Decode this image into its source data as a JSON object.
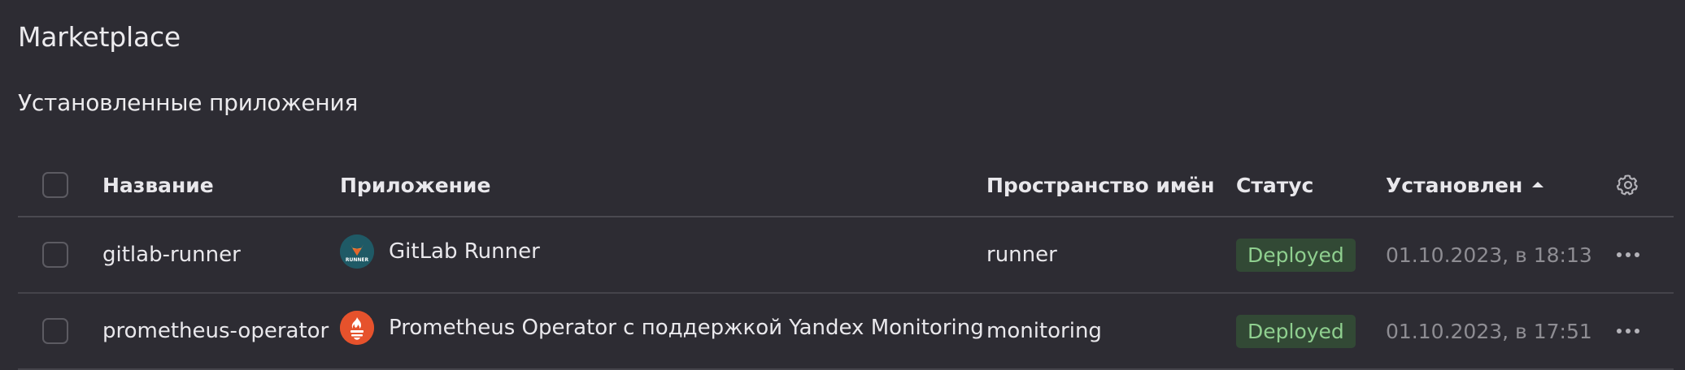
{
  "page": {
    "title": "Marketplace",
    "section_title": "Установленные приложения"
  },
  "table": {
    "columns": {
      "name": "Название",
      "app": "Приложение",
      "namespace": "Пространство имён",
      "status": "Статус",
      "installed": "Установлен"
    },
    "sort": {
      "column": "installed",
      "direction": "asc"
    },
    "rows": [
      {
        "name": "gitlab-runner",
        "app": "GitLab Runner",
        "app_icon": "gitlab-runner-icon",
        "app_icon_label": "RUNNER",
        "namespace": "runner",
        "status": "Deployed",
        "installed": "01.10.2023, в 18:13"
      },
      {
        "name": "prometheus-operator",
        "app": "Prometheus Operator с поддержкой Yandex Monitoring",
        "app_icon": "prometheus-icon",
        "namespace": "monitoring",
        "status": "Deployed",
        "installed": "01.10.2023, в 17:51"
      }
    ]
  },
  "colors": {
    "background": "#2d2c33",
    "status_badge_bg": "#324935",
    "status_badge_text": "#8fcf8f",
    "prometheus_orange": "#e6522c",
    "gitlab_runner_teal": "#1f5a66"
  }
}
